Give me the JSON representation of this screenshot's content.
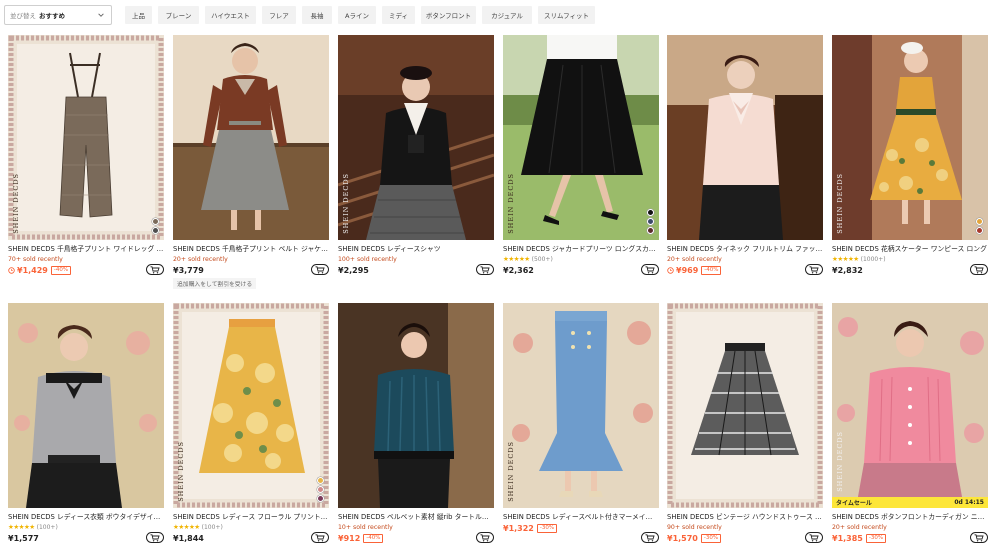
{
  "sort": {
    "prefix": "並び替え",
    "value": "おすすめ"
  },
  "filters": [
    "上品",
    "プレーン",
    "ハイウエスト",
    "フレア",
    "長袖",
    "Aライン",
    "ミディ",
    "ボタンフロント",
    "カジュアル",
    "スリムフィット"
  ],
  "colors": {
    "sale": "#fa6338",
    "sold": "#c44a1c",
    "star": "#f0b400",
    "time_sale_bg": "#fde63a"
  },
  "brand_watermark": "SHEIN DECDS",
  "products": [
    {
      "title": "SHEIN DECDS 千鳥格子プリント ワイドレッグ ジャンプスーツ",
      "sold": "70+ sold recently",
      "price": "¥1,429",
      "discount": "-40%",
      "icon": "clock-icon"
    },
    {
      "title": "SHEIN DECDS 千鳥格子プリント ベルト ジャケット & スカート",
      "sold": "20+ sold recently",
      "price": "¥3,779",
      "promo": "追加購入をして割引を受ける"
    },
    {
      "title": "SHEIN DECDS レディースシャツ",
      "sold": "100+ sold recently",
      "price": "¥2,295"
    },
    {
      "title": "SHEIN DECDS ジャカードプリーツ ロングスカート",
      "stars": "★★★★★",
      "rating_count": "(500+)",
      "price": "¥2,362"
    },
    {
      "title": "SHEIN DECDS タイネック フリルトリム ファッションブラウス",
      "sold": "20+ sold recently",
      "price": "¥969",
      "discount": "-40%",
      "icon": "clock-icon"
    },
    {
      "title": "SHEIN DECDS 花柄スケーター ワンピース ロング",
      "stars": "★★★★★",
      "rating_count": "(1000+)",
      "price": "¥2,832"
    },
    {
      "title": "SHEIN DECDS レディース衣類 ボウタイデザイン ブラウス",
      "stars": "★★★★★",
      "rating_count": "(100+)",
      "price": "¥1,577"
    },
    {
      "title": "SHEIN DECDS レディース フローラル プリント スカート",
      "stars": "★★★★★",
      "rating_count": "(100+)",
      "price": "¥1,844"
    },
    {
      "title": "SHEIN DECDS ベルベット素材 縦rib タートルネック トップス",
      "sold": "10+ sold recently",
      "price": "¥912",
      "discount": "-40%"
    },
    {
      "title": "SHEIN DECDS レディースベルト付きマーメイド スカート",
      "price": "¥1,322",
      "discount": "-30%"
    },
    {
      "title": "SHEIN DECDS ビンテージ ハウンドストゥース スカート",
      "sold": "90+ sold recently",
      "price": "¥1,570",
      "discount": "-30%"
    },
    {
      "title": "SHEIN DECDS ボタンフロントカーディガン ニット",
      "sold": "20+ sold recently",
      "price": "¥1,385",
      "discount": "-30%",
      "time_sale_label": "タイムセール",
      "time_sale_timer": "0d 14:15"
    }
  ]
}
